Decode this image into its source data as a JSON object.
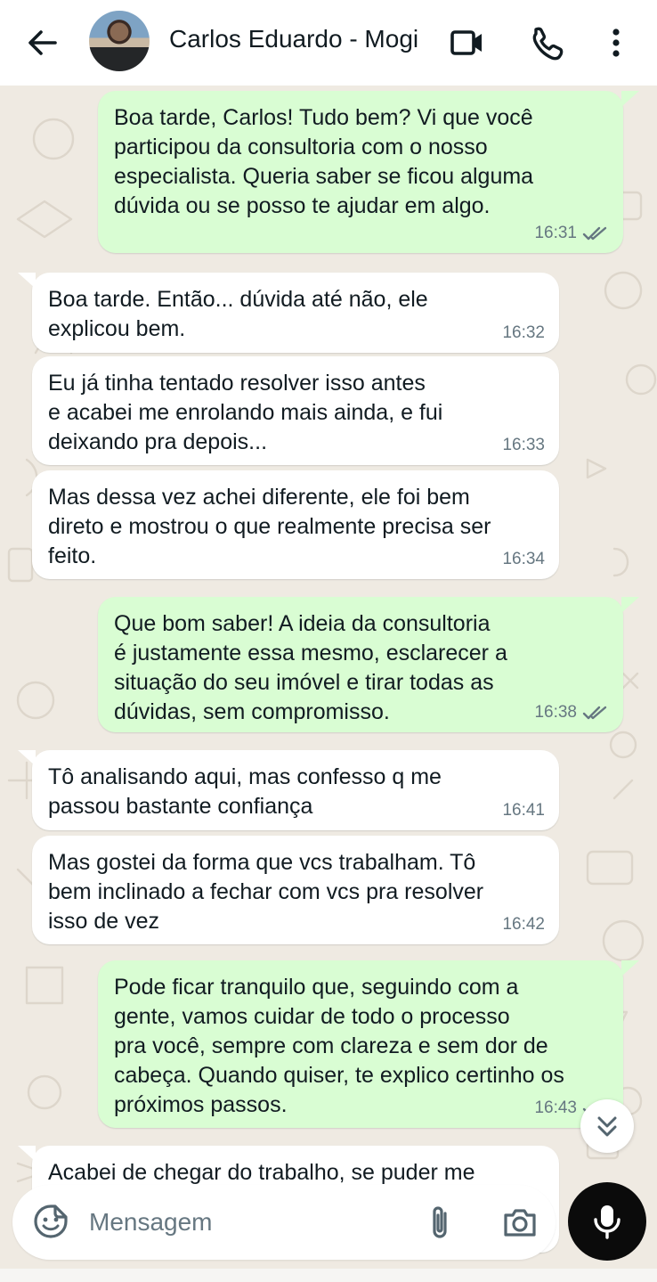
{
  "header": {
    "contact_name": "Carlos Eduardo - Mogi",
    "icons": [
      "back-arrow-icon",
      "video-call-icon",
      "voice-call-icon",
      "more-options-icon"
    ]
  },
  "messages": [
    {
      "direction": "out",
      "text": "Boa tarde, Carlos! Tudo bem? Vi que você\nparticipou da consultoria com o nosso\nespecialista. Queria saber se ficou alguma\ndúvida ou se posso te ajudar em algo.",
      "time": "16:31",
      "status": "read"
    },
    {
      "direction": "in",
      "text": "Boa tarde. Então... dúvida até não, ele\nexplicou bem.",
      "time": "16:32"
    },
    {
      "direction": "in",
      "text": "Eu já tinha tentado resolver isso antes\ne acabei me enrolando mais ainda, e fui\ndeixando pra depois...",
      "time": "16:33"
    },
    {
      "direction": "in",
      "text": "Mas dessa vez achei diferente, ele foi bem\ndireto e mostrou o que realmente precisa ser\nfeito.",
      "time": "16:34"
    },
    {
      "direction": "out",
      "text": "Que bom saber! A ideia da consultoria\né justamente essa mesmo, esclarecer a\nsituação do seu imóvel e tirar todas as\ndúvidas, sem compromisso.",
      "time": "16:38",
      "status": "read"
    },
    {
      "direction": "in",
      "text": "Tô analisando aqui, mas confesso q me\npassou bastante confiança",
      "time": "16:41"
    },
    {
      "direction": "in",
      "text": "Mas gostei da forma que vcs trabalham. Tô\nbem inclinado a fechar com vcs pra resolver\nisso de vez",
      "time": "16:42"
    },
    {
      "direction": "out",
      "text": "Pode ficar tranquilo que, seguindo com a\ngente, vamos cuidar de todo o processo\npra você, sempre com clareza e sem dor de\ncabeça. Quando quiser, te explico certinho os\npróximos passos.",
      "time": "16:43",
      "status": "read"
    },
    {
      "direction": "in",
      "text": "Acabei de chegar do trabalho, se puder me",
      "time": ""
    }
  ],
  "composer": {
    "placeholder": "Mensagem",
    "icons": [
      "sticker-icon",
      "attach-clip-icon",
      "camera-icon",
      "microphone-icon"
    ]
  },
  "colors": {
    "outgoing_bubble": "#d9fdd3",
    "incoming_bubble": "#ffffff",
    "chat_background": "#efeae2",
    "read_ticks": "#667781",
    "mic_button": "#0b0b0b"
  }
}
